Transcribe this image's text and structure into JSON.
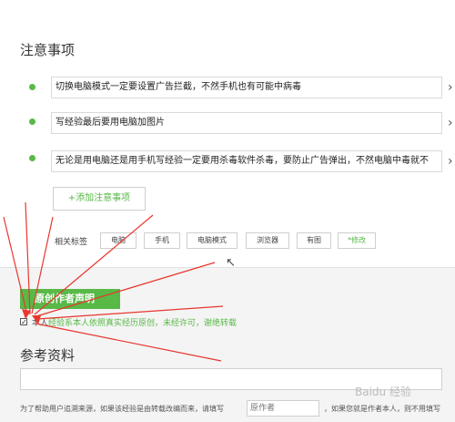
{
  "notes": {
    "title": "注意事项",
    "items": [
      {
        "text": "切换电脑模式一定要设置广告拦截，不然手机也有可能中病毒"
      },
      {
        "text": "写经验最后要用电脑加图片"
      },
      {
        "text": "无论是用电脑还是用手机写经验一定要用杀毒软件杀毒，要防止广告弹出，不然电脑中毒就不"
      }
    ],
    "add_button": "+添加注意事项"
  },
  "tags": {
    "label": "相关标签",
    "items": [
      "电脑",
      "手机",
      "电脑模式",
      "浏览器",
      "有图"
    ],
    "edit": "*修改"
  },
  "original": {
    "button": "原创作者声明",
    "checkbox_checked": true,
    "declaration_prefix": "本人",
    "declaration": "经验系本人依照真实经历原创，未经许可，谢绝转载"
  },
  "reference": {
    "title": "参考资料",
    "helper_prefix": "为了帮助用户追溯来源，如果该经验是由转载改编而来，请填写",
    "author_placeholder": "原作者",
    "helper_suffix": "，如果您就是作者本人，则不用填写"
  },
  "watermark": "Baidu 经验",
  "colors": {
    "accent": "#58b947",
    "annotation_arrows": "#e8372e"
  }
}
